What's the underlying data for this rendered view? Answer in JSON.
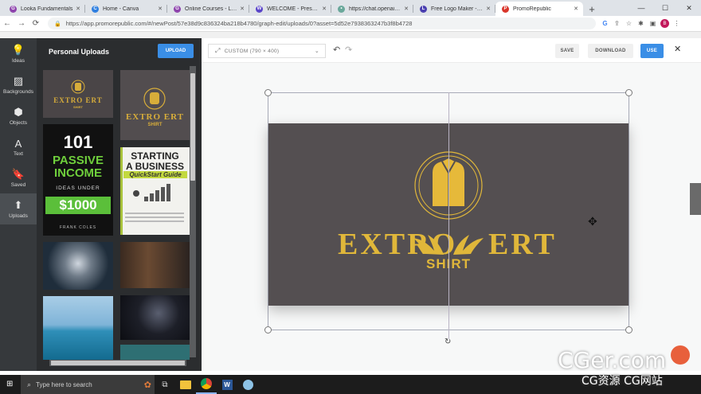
{
  "tabs": [
    {
      "title": "Looka Fundamentals",
      "color": "#8e44ad",
      "letter": "G"
    },
    {
      "title": "Home - Canva",
      "color": "#2f7fe0",
      "letter": "C"
    },
    {
      "title": "Online Courses - Learn",
      "color": "#8e44ad",
      "letter": "G"
    },
    {
      "title": "WELCOME - Presentation",
      "color": "#5a45c9",
      "letter": "W"
    },
    {
      "title": "https://chat.openai.com",
      "color": "#6aa89b",
      "letter": "•"
    },
    {
      "title": "Free Logo Maker - Get",
      "color": "#4a3fb0",
      "letter": "L"
    },
    {
      "title": "PromoRepublic",
      "color": "#d9362b",
      "letter": "P"
    }
  ],
  "address": {
    "url": "https://app.promorepublic.com/#/newPost/57e38d9c836324ba218b4780/graph-edit/uploads/0?asset=5d52e7938363247b3f8b4728"
  },
  "profile": {
    "letter": "B"
  },
  "sidebar": {
    "items": [
      {
        "label": "Ideas",
        "icon": "lightbulb-icon",
        "glyph": "💡"
      },
      {
        "label": "Backgrounds",
        "icon": "image-icon",
        "glyph": "▨"
      },
      {
        "label": "Objects",
        "icon": "cube-icon",
        "glyph": "⬢"
      },
      {
        "label": "Text",
        "icon": "text-icon",
        "glyph": "A"
      },
      {
        "label": "Saved",
        "icon": "bookmark-icon",
        "glyph": "🔖"
      },
      {
        "label": "Uploads",
        "icon": "upload-icon",
        "glyph": "⬆"
      }
    ]
  },
  "panel": {
    "title": "Personal Uploads",
    "upload_label": "UPLOAD"
  },
  "thumbs": {
    "logo_small": {
      "brand": "EXTRO ERT",
      "sub": "SHIRT"
    },
    "logo_big": {
      "brand": "EXTRO ERT",
      "sub": "SHIRT"
    },
    "book1": {
      "l1": "101",
      "l2": "PASSIVE",
      "l3": "INCOME",
      "l4": "IDEAS UNDER",
      "l5": "$1000",
      "l6": "FRANK COLES"
    },
    "book2": {
      "l1": "STARTING",
      "l2": "A BUSINESS",
      "l3": "QuickStart Guide"
    }
  },
  "toolbar": {
    "size_label": "CUSTOM (790 × 400)",
    "save": "SAVE",
    "download": "DOWNLOAD",
    "use": "USE"
  },
  "design": {
    "brand_left": "EXTRO",
    "brand_right": "ERT",
    "sub": "SHIRT",
    "bg": "#544f51",
    "gold": "#e0b73a"
  },
  "taskbar": {
    "search_placeholder": "Type here to search"
  },
  "watermark": {
    "main": "CGer.com",
    "sub": "CG资源 CG网站"
  }
}
